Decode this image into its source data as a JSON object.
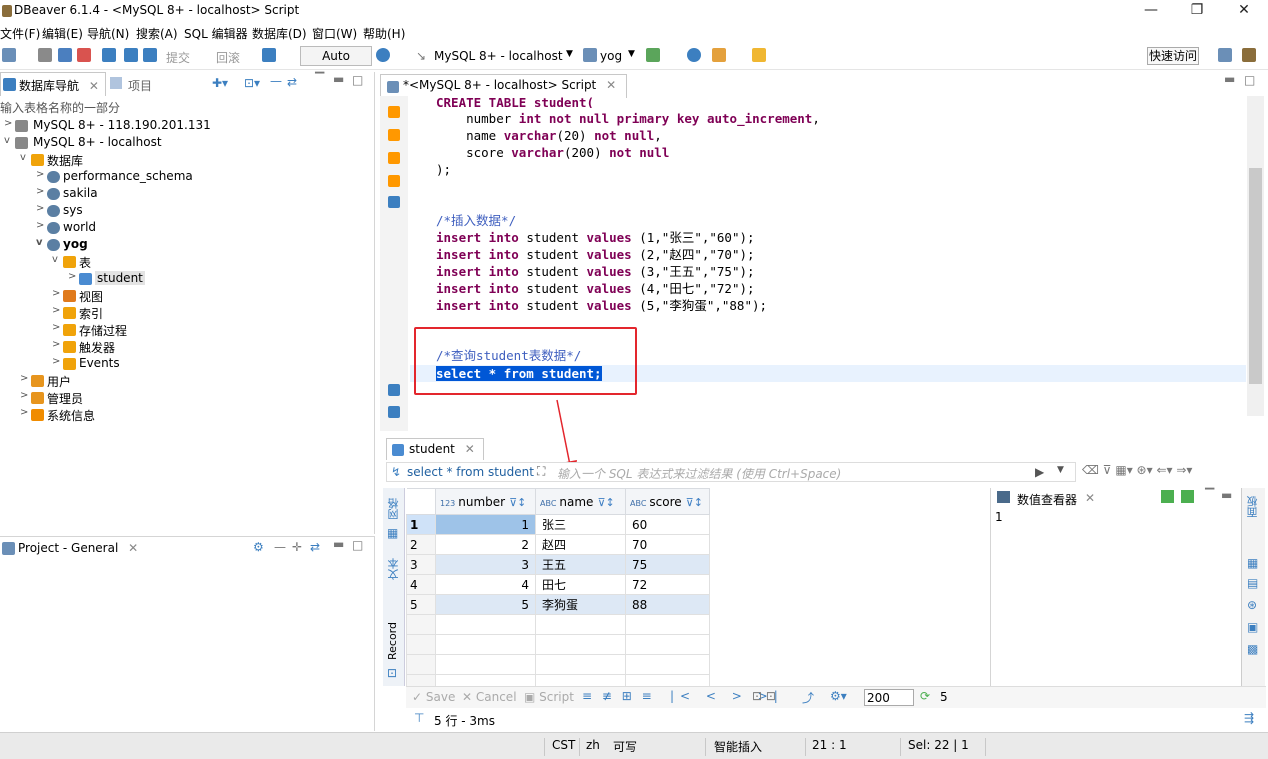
{
  "window": {
    "title": "DBeaver 6.1.4 - <MySQL 8+ - localhost> Script",
    "min": "—",
    "max": "❐",
    "close": "✕"
  },
  "menu": [
    "文件(F)",
    "编辑(E)",
    "导航(N)",
    "搜索(A)",
    "SQL 编辑器",
    "数据库(D)",
    "窗口(W)",
    "帮助(H)"
  ],
  "toolbar": {
    "commit": "提交",
    "rollback": "回滚",
    "mode": "Auto",
    "connection": "MySQL 8+ - localhost",
    "schema": "yog",
    "quick_access": "快速访问"
  },
  "navigator": {
    "tab": "数据库导航",
    "tab2": "项目",
    "filter_placeholder": "输入表格名称的一部分",
    "tree": [
      {
        "label": "MySQL 8+ - 118.190.201.131",
        "twisty": ">"
      },
      {
        "label": "MySQL 8+ - localhost",
        "twisty": "v"
      },
      {
        "label": "数据库",
        "twisty": "v"
      },
      {
        "label": "performance_schema",
        "twisty": ">"
      },
      {
        "label": "sakila",
        "twisty": ">"
      },
      {
        "label": "sys",
        "twisty": ">"
      },
      {
        "label": "world",
        "twisty": ">"
      },
      {
        "label": "yog",
        "twisty": "v"
      },
      {
        "label": "表",
        "twisty": "v"
      },
      {
        "label": "student",
        "twisty": ">"
      },
      {
        "label": "视图",
        "twisty": ">"
      },
      {
        "label": "索引",
        "twisty": ">"
      },
      {
        "label": "存储过程",
        "twisty": ">"
      },
      {
        "label": "触发器",
        "twisty": ">"
      },
      {
        "label": "Events",
        "twisty": ">"
      },
      {
        "label": "用户",
        "twisty": ">"
      },
      {
        "label": "管理员",
        "twisty": ">"
      },
      {
        "label": "系统信息",
        "twisty": ">"
      }
    ]
  },
  "project": {
    "tab": "Project - General"
  },
  "editor": {
    "tab": "*<MySQL 8+ - localhost> Script",
    "lines": {
      "l1": "CREATE TABLE student(",
      "l2a": "number",
      "l2b": "int",
      "l2c": "not null",
      "l2d": "primary key auto_increment",
      "l3a": "name",
      "l3b": "varchar",
      "l3c": "(20)",
      "l3d": "not null",
      "l4a": "score",
      "l4b": "varchar",
      "l4c": "(200)",
      "l4d": "not null",
      "l5": ");",
      "c1": "/*插入数据*/",
      "ins": [
        [
          "(1,\"张三\",\"60\");"
        ],
        [
          "(2,\"赵四\",\"70\");"
        ],
        [
          "(3,\"王五\",\"75\");"
        ],
        [
          "(4,\"田七\",\"72\");"
        ],
        [
          "(5,\"李狗蛋\",\"88\");"
        ]
      ],
      "c2": "/*查询student表数据*/",
      "sel": "select * from student;"
    }
  },
  "results": {
    "tab": "student",
    "query": "select * from student",
    "filter_placeholder": "输入一个 SQL 表达式来过滤结果 (使用 Ctrl+Space)",
    "side_tabs": [
      "网格",
      "文本",
      "Record"
    ],
    "columns": [
      {
        "type": "123",
        "name": "number"
      },
      {
        "type": "ABC",
        "name": "name"
      },
      {
        "type": "ABC",
        "name": "score"
      }
    ],
    "rows": [
      [
        "1",
        "1",
        "张三",
        "60"
      ],
      [
        "2",
        "2",
        "赵四",
        "70"
      ],
      [
        "3",
        "3",
        "王五",
        "75"
      ],
      [
        "4",
        "4",
        "田七",
        "72"
      ],
      [
        "5",
        "5",
        "李狗蛋",
        "88"
      ]
    ],
    "value_viewer": {
      "title": "数值查看器",
      "value": "1",
      "side_label": "面板"
    },
    "bottom": {
      "save": "Save",
      "cancel": "Cancel",
      "script": "Script",
      "limit": "200",
      "count": "5"
    },
    "summary": "5 行 - 3ms"
  },
  "status": {
    "tz": "CST",
    "lang": "zh",
    "mode": "可写",
    "insert": "智能插入",
    "pos": "21 :  1",
    "sel": "Sel: 22 | 1"
  }
}
